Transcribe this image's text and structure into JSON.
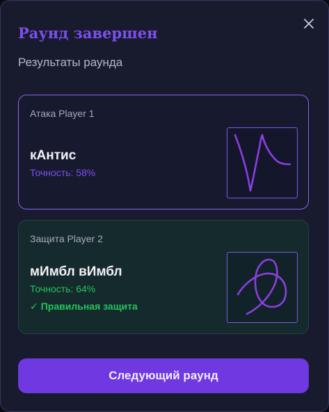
{
  "dialog": {
    "title": "Раунд завершен",
    "subtitle": "Результаты раунда"
  },
  "attack": {
    "label": "Атака Player 1",
    "word": "кАнтис",
    "accuracy": "Точность: 58%",
    "accent": "#8a62f5"
  },
  "defense": {
    "label": "Защита Player 2",
    "word": "мИмбл вИмбл",
    "accuracy": "Точность: 64%",
    "status": "Правильная защита",
    "status_icon": "check-icon",
    "accent": "#22c55e"
  },
  "actions": {
    "next_label": "Следующий раунд",
    "close_icon": "close-icon"
  },
  "colors": {
    "primary": "#7038e0",
    "title": "#7c4ff0",
    "success": "#22c55e",
    "stroke": "#8b3fe0"
  }
}
